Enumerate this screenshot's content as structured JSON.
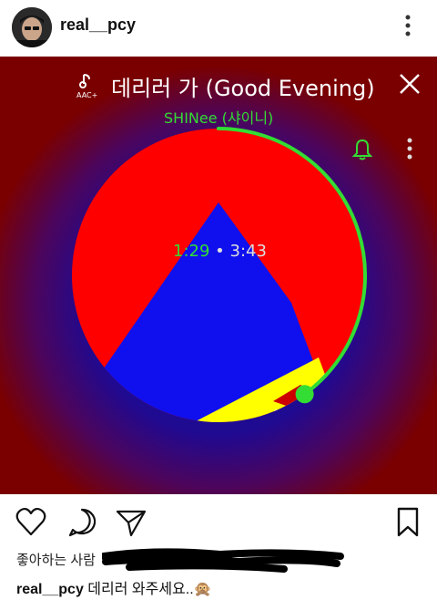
{
  "post": {
    "username": "real__pcy"
  },
  "player": {
    "badge": "AAC+",
    "title": "데리러 가 (Good Evening)",
    "artist": "SHINee (샤이니)",
    "elapsed": "1:29",
    "separator": "•",
    "duration": "3:43",
    "progress": 0.4,
    "colors": {
      "background": "#7a0000",
      "glow": "#1a0a9a",
      "red": "#ff0000",
      "blue": "#1010ee",
      "yellow": "#ffff00",
      "accent": "#33dd33"
    }
  },
  "likes": {
    "text": "좋아하는 사람"
  },
  "caption": {
    "username": "real__pcy",
    "text": "데리러 와주세요..🙊"
  },
  "icons": [
    "more-vertical-icon",
    "aac-logo-icon",
    "close-icon",
    "bell-icon",
    "heart-icon",
    "comment-icon",
    "send-icon",
    "bookmark-icon"
  ]
}
